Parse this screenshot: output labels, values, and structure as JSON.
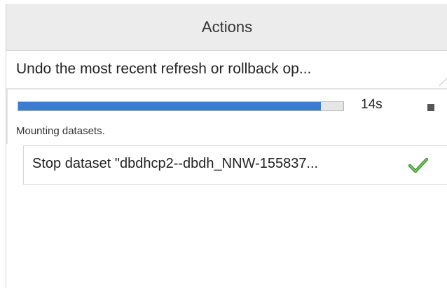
{
  "header": {
    "title": "Actions"
  },
  "summary": {
    "text": "Undo the most recent refresh or rollback op..."
  },
  "progress": {
    "fraction": 0.93,
    "elapsed": "14s",
    "status": "Mounting datasets.",
    "fill_color": "#3c7cd0"
  },
  "actions": [
    {
      "label": "Stop dataset \"dbdhcp2--dbdh_NNW-155837...",
      "state": "completed",
      "icon": "checkmark-icon"
    }
  ],
  "colors": {
    "header_bg": "#ececec",
    "check_green": "#4a9a3a"
  }
}
